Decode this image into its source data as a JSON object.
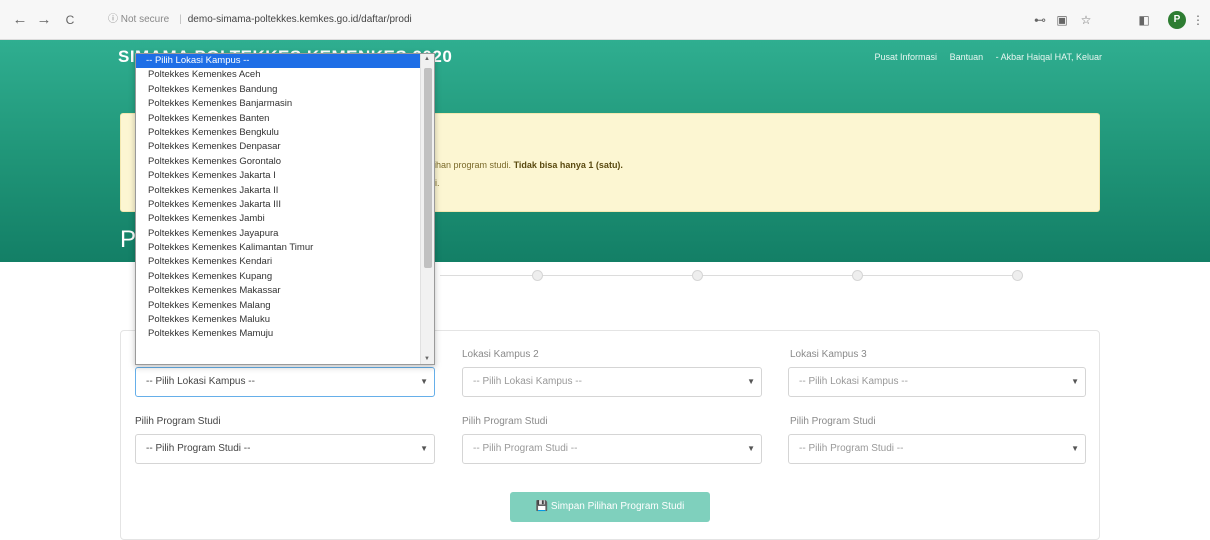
{
  "browser": {
    "back_icon": "←",
    "forward_icon": "→",
    "reload_icon": "C",
    "security_label": "ⓘ Not secure",
    "url": "demo-simama-poltekkes.kemkes.go.id/daftar/prodi",
    "key_icon": "⊷",
    "translate_icon": "▣",
    "star_icon": "☆",
    "ext_icon": "◧",
    "profile_initial": "P",
    "menu_icon": "⋮"
  },
  "header": {
    "brand": "SIMAMA POLTEKKES KEMENKES 2020",
    "nav": [
      "Pusat Informasi",
      "Bantuan",
      "- Akbar Haiqal HAT, Keluar"
    ],
    "page_title_letter": "P"
  },
  "alert": {
    "line1_prefix": "ilihan program studi.",
    "line1_bold": "Tidak bisa hanya 1 (satu).",
    "line2": "gi."
  },
  "form": {
    "lokasi2_label": "Lokasi Kampus 2",
    "lokasi3_label": "Lokasi Kampus 3",
    "lokasi_placeholder": "-- Pilih Lokasi Kampus --",
    "prodi_label": "Pilih Program Studi",
    "prodi_placeholder": "-- Pilih Program Studi --",
    "save_label": "Simpan Pilihan Program Studi",
    "save_icon": "💾"
  },
  "dropdown": {
    "selected": "-- Pilih Lokasi Kampus --",
    "options": [
      "Poltekkes Kemenkes Aceh",
      "Poltekkes Kemenkes Bandung",
      "Poltekkes Kemenkes Banjarmasin",
      "Poltekkes Kemenkes Banten",
      "Poltekkes Kemenkes Bengkulu",
      "Poltekkes Kemenkes Denpasar",
      "Poltekkes Kemenkes Gorontalo",
      "Poltekkes Kemenkes Jakarta I",
      "Poltekkes Kemenkes Jakarta II",
      "Poltekkes Kemenkes Jakarta III",
      "Poltekkes Kemenkes Jambi",
      "Poltekkes Kemenkes Jayapura",
      "Poltekkes Kemenkes Kalimantan Timur",
      "Poltekkes Kemenkes Kendari",
      "Poltekkes Kemenkes Kupang",
      "Poltekkes Kemenkes Makassar",
      "Poltekkes Kemenkes Malang",
      "Poltekkes Kemenkes Maluku",
      "Poltekkes Kemenkes Mamuju"
    ]
  },
  "colors": {
    "header_green": "#1f9477",
    "alert_bg": "#fcf6d2",
    "selected_option": "#1e6ee6",
    "save_button": "#7fd0bd"
  }
}
